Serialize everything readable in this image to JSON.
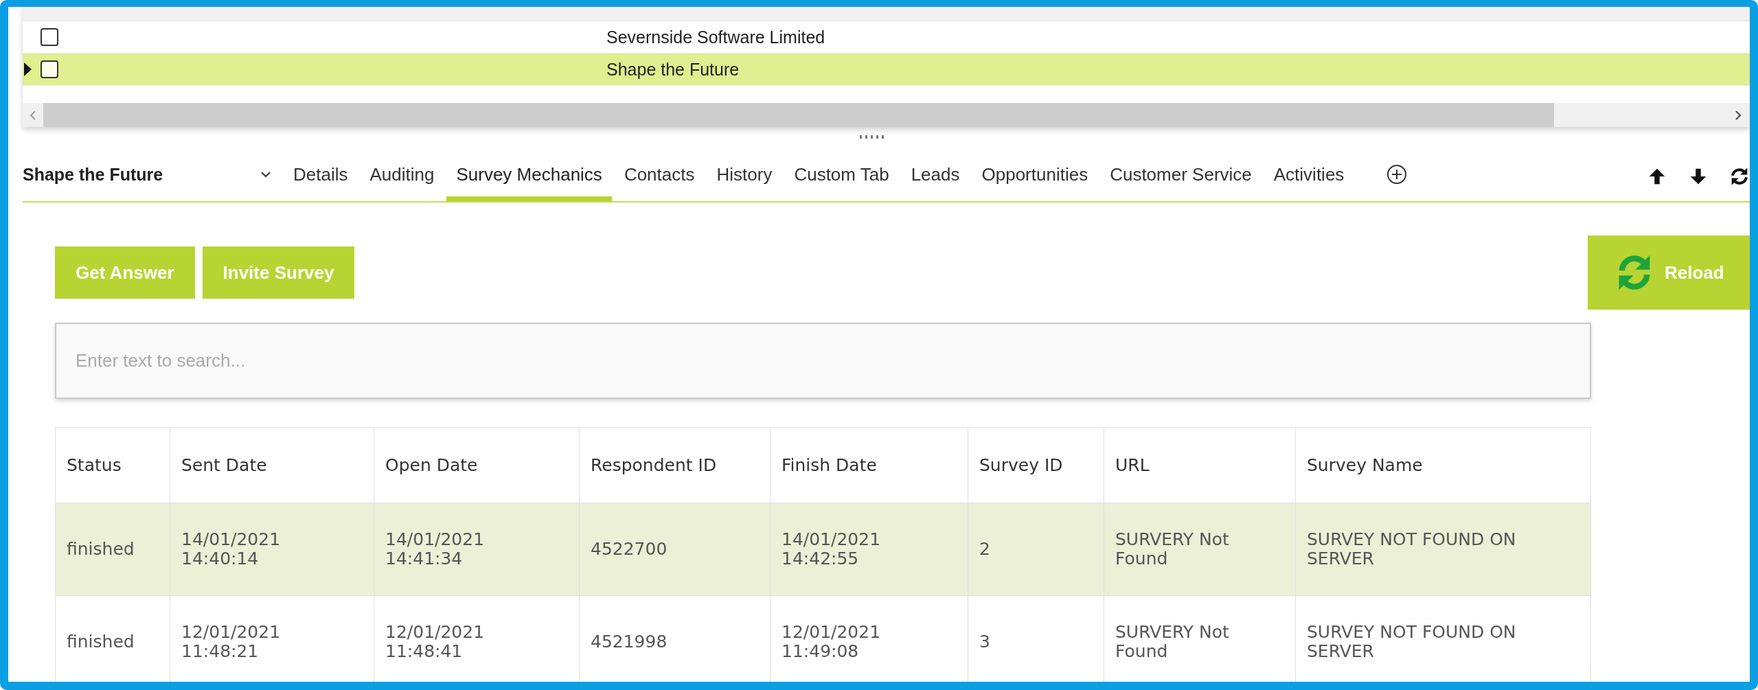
{
  "grid": {
    "rows": [
      {
        "name": "Severnside Software Limited",
        "checked": false,
        "selected": false
      },
      {
        "name": "Shape the Future",
        "checked": false,
        "selected": true
      }
    ]
  },
  "record": {
    "title": "Shape the Future",
    "tabs": [
      {
        "label": "Details",
        "selected": false
      },
      {
        "label": "Auditing",
        "selected": false
      },
      {
        "label": "Survey Mechanics",
        "selected": true
      },
      {
        "label": "Contacts",
        "selected": false
      },
      {
        "label": "History",
        "selected": false
      },
      {
        "label": "Custom Tab",
        "selected": false
      },
      {
        "label": "Leads",
        "selected": false
      },
      {
        "label": "Opportunities",
        "selected": false
      },
      {
        "label": "Customer Service",
        "selected": false
      },
      {
        "label": "Activities",
        "selected": false
      }
    ]
  },
  "actions": [
    "Get Answer",
    "Invite Survey"
  ],
  "reload": "Reload",
  "search": {
    "placeholder": "Enter text to search..."
  },
  "table": {
    "columns": [
      "Status",
      "Sent Date",
      "Open Date",
      "Respondent ID",
      "Finish Date",
      "Survey ID",
      "URL",
      "Survey Name"
    ],
    "rows": [
      {
        "selected": true,
        "cells": [
          "finished",
          "14/01/2021\n14:40:14",
          "14/01/2021\n14:41:34",
          "4522700",
          "14/01/2021\n14:42:55",
          "2",
          "SURVERY Not Found",
          "SURVEY NOT FOUND ON SERVER"
        ]
      },
      {
        "selected": false,
        "cells": [
          "finished",
          "12/01/2021\n11:48:21",
          "12/01/2021\n11:48:41",
          "4521998",
          "12/01/2021\n11:49:08",
          "3",
          "SURVERY Not Found",
          "SURVEY NOT FOUND ON SERVER"
        ]
      }
    ]
  }
}
